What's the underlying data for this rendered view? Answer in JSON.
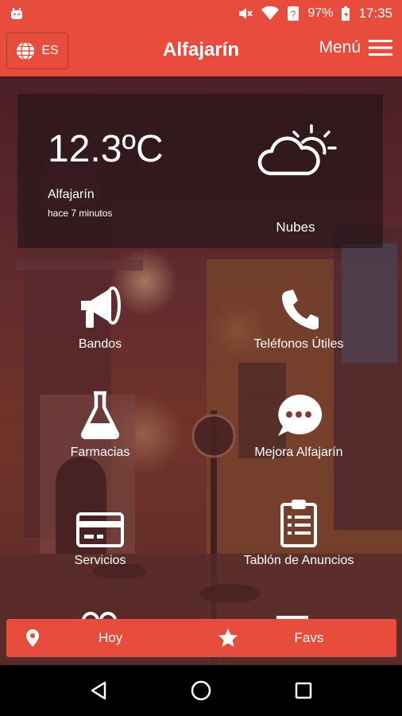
{
  "status_bar": {
    "battery": "97%",
    "time": "17:35"
  },
  "header": {
    "lang": "ES",
    "title": "Alfajarín",
    "menu_label": "Menú"
  },
  "weather": {
    "temperature": "12.3ºC",
    "location": "Alfajarín",
    "updated": "hace 7 minutos",
    "condition": "Nubes"
  },
  "tiles": [
    {
      "label": "Bandos",
      "icon": "megaphone-icon"
    },
    {
      "label": "Teléfonos Útiles",
      "icon": "phone-icon"
    },
    {
      "label": "Farmacias",
      "icon": "flask-icon"
    },
    {
      "label": "Mejora Alfajarín",
      "icon": "chat-bubble-icon"
    },
    {
      "label": "Servicios",
      "icon": "credit-card-icon"
    },
    {
      "label": "Tablón de Anuncios",
      "icon": "clipboard-icon"
    }
  ],
  "bottom_nav": {
    "today": "Hoy",
    "favs": "Favs"
  },
  "colors": {
    "accent": "#e74c3c"
  }
}
